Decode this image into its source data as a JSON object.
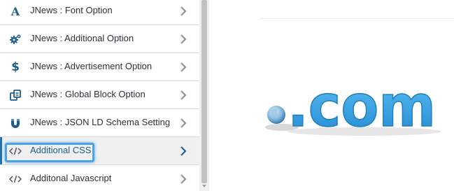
{
  "sidebar": {
    "items": [
      {
        "label": "JNews : Font Option",
        "icon": "font-icon"
      },
      {
        "label": "JNews : Additional Option",
        "icon": "gears-icon"
      },
      {
        "label": "JNews : Advertisement Option",
        "icon": "dollar-icon"
      },
      {
        "label": "JNews : Global Block Option",
        "icon": "blocks-icon"
      },
      {
        "label": "JNews : JSON LD Schema Setting",
        "icon": "magnet-icon"
      },
      {
        "label": "Additional CSS",
        "icon": "code-icon",
        "active": true
      },
      {
        "label": "Additonal Javascript",
        "icon": "code-icon"
      }
    ]
  },
  "preview": {
    "logo_text": ".com",
    "logo_color": "#3aa0e0"
  },
  "colors": {
    "accent": "#2271b1",
    "highlight": "#4aa3e6",
    "icon": "#1d5d86"
  }
}
